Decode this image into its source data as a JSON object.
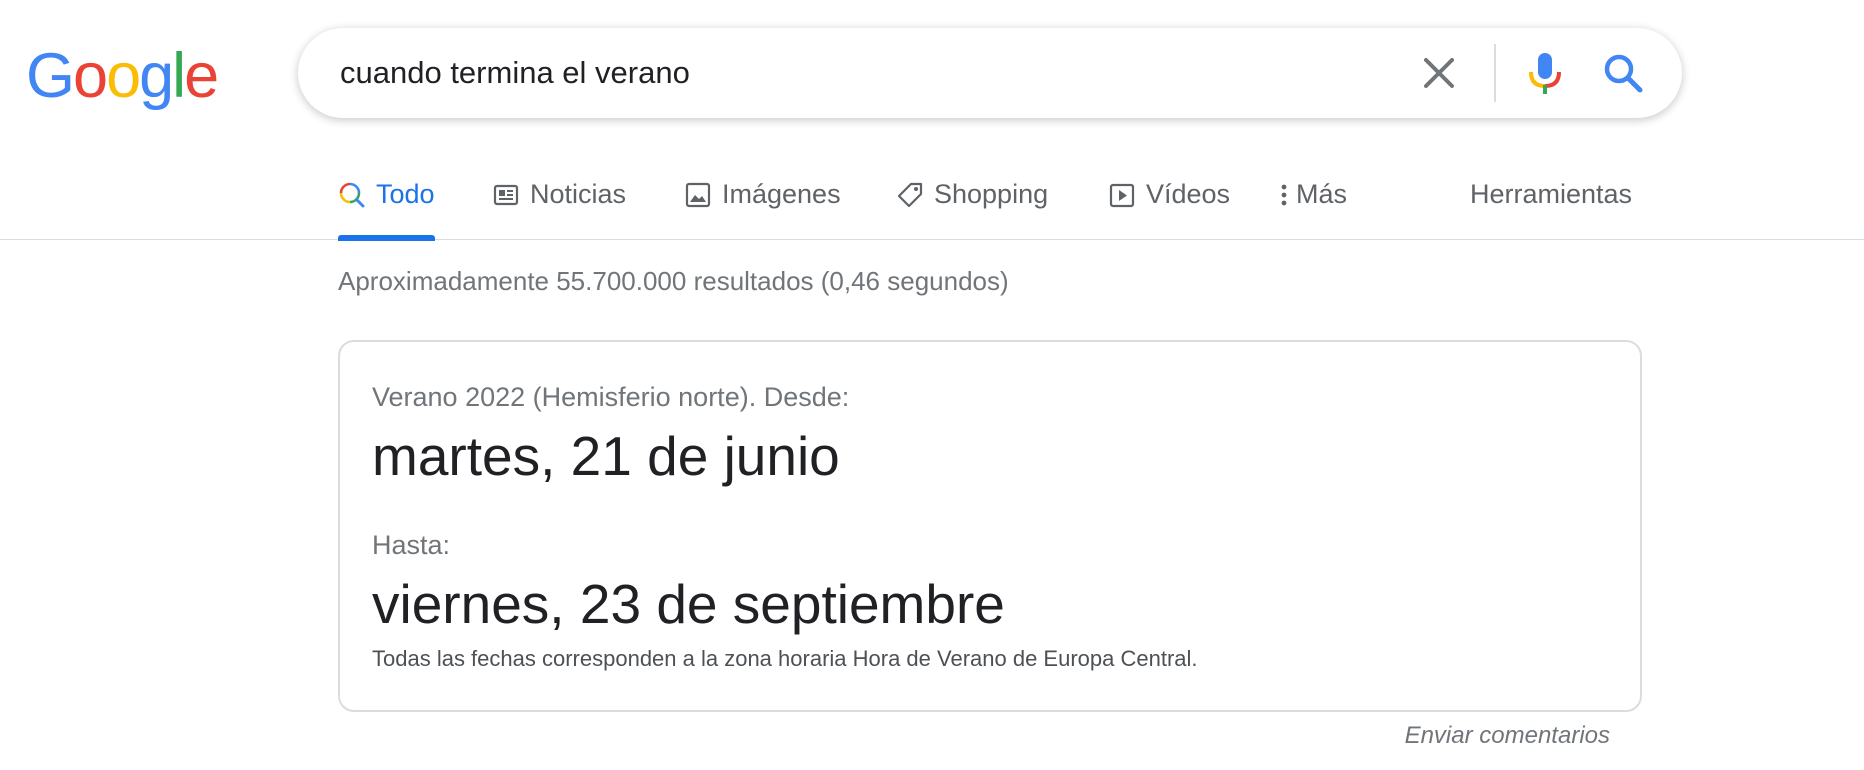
{
  "logo": {
    "letters": [
      {
        "char": "G",
        "color": "#4285F4"
      },
      {
        "char": "o",
        "color": "#EA4335"
      },
      {
        "char": "o",
        "color": "#FBBC05"
      },
      {
        "char": "g",
        "color": "#4285F4"
      },
      {
        "char": "l",
        "color": "#34A853"
      },
      {
        "char": "e",
        "color": "#EA4335"
      }
    ]
  },
  "search": {
    "query": "cuando termina el verano",
    "icons": {
      "clear": "close-icon",
      "voice": "microphone-icon",
      "submit": "search-icon"
    }
  },
  "tabs": [
    {
      "label": "Todo",
      "icon": "search-icon",
      "active": true
    },
    {
      "label": "Noticias",
      "icon": "newspaper-icon",
      "active": false
    },
    {
      "label": "Imágenes",
      "icon": "image-icon",
      "active": false
    },
    {
      "label": "Shopping",
      "icon": "tag-icon",
      "active": false
    },
    {
      "label": "Vídeos",
      "icon": "play-icon",
      "active": false
    },
    {
      "label": "Más",
      "icon": "more-vert-icon",
      "active": false
    }
  ],
  "tools_label": "Herramientas",
  "result_stats": "Aproximadamente 55.700.000 resultados (0,46 segundos)",
  "answer_card": {
    "from_label": "Verano 2022 (Hemisferio norte). Desde:",
    "from_date": "martes, 21 de junio",
    "to_label": "Hasta:",
    "to_date": "viernes, 23 de septiembre",
    "timezone_note": "Todas las fechas corresponden a la zona horaria Hora de Verano de Europa Central."
  },
  "feedback_label": "Enviar comentarios",
  "colors": {
    "accent": "#1a73e8",
    "text_primary": "#202124",
    "text_secondary": "#70757a",
    "border": "#dadce0"
  }
}
